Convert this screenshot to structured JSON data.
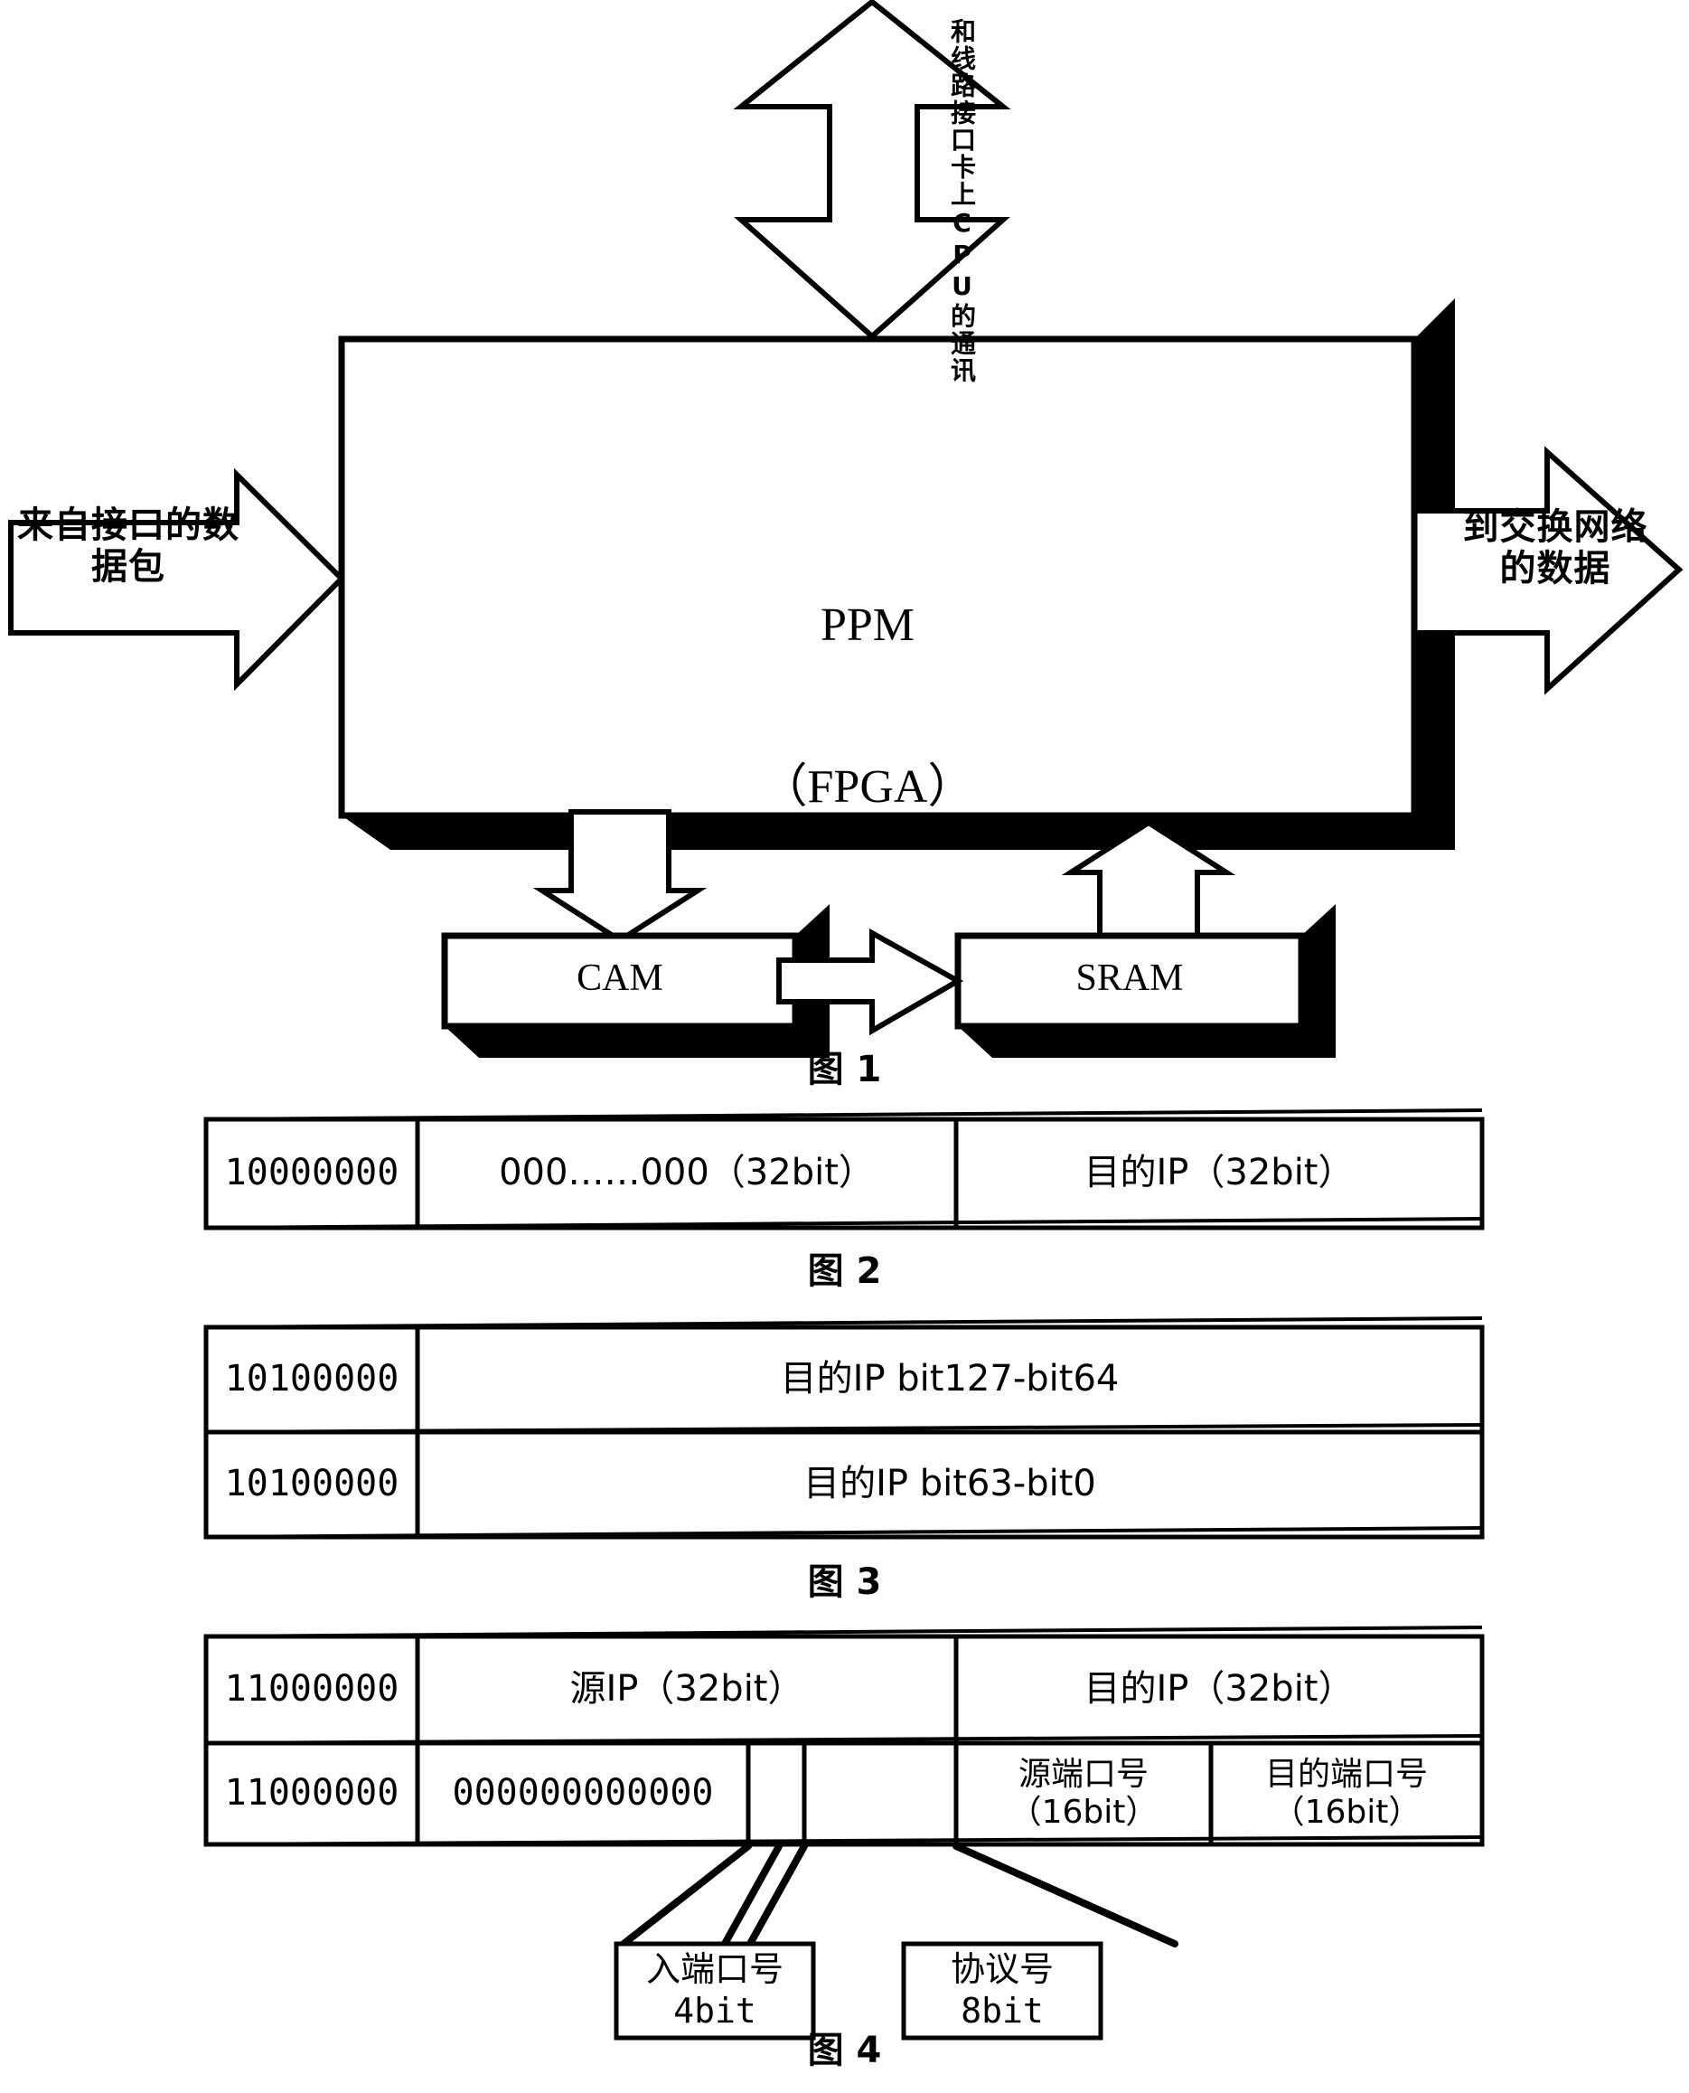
{
  "figure1": {
    "caption": "图 1",
    "main_block": {
      "line1": "PPM",
      "line2": "（FPGA）"
    },
    "top_arrow_label": "和线路接口卡上CPU的通讯",
    "left_arrow_label": "来自接口的数\n据包",
    "right_arrow_label": "到交换网络\n的数据",
    "cam_label": "CAM",
    "sram_label": "SRAM"
  },
  "figure2": {
    "caption": "图 2",
    "rows": [
      [
        "10000000",
        "000……000（32bit）",
        "目的IP（32bit）"
      ]
    ]
  },
  "figure3": {
    "caption": "图 3",
    "rows": [
      [
        "10100000",
        "目的IP bit127-bit64"
      ],
      [
        "10100000",
        "目的IP bit63-bit0"
      ]
    ]
  },
  "figure4": {
    "caption": "图 4",
    "row1": [
      "11000000",
      "源IP（32bit）",
      "目的IP（32bit）"
    ],
    "row2": {
      "flag": "11000000",
      "zeros": "000000000000",
      "narrow_cell_1": "",
      "narrow_cell_2": "",
      "src_port": "源端口号\n（16bit）",
      "dst_port": "目的端口号\n（16bit）"
    },
    "callouts": [
      {
        "title": "入端口号",
        "bits": "4bit"
      },
      {
        "title": "协议号",
        "bits": "8bit"
      }
    ]
  }
}
